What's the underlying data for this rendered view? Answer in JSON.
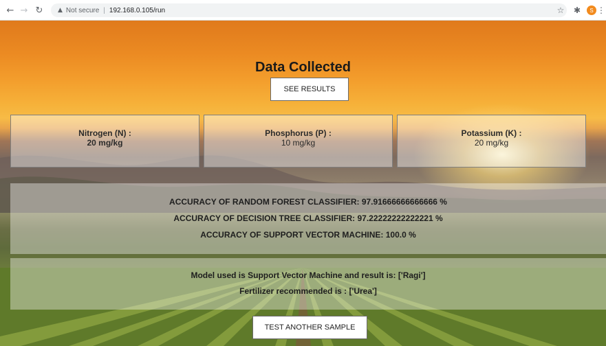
{
  "browser": {
    "security_label": "Not secure",
    "url": "192.168.0.105/run",
    "profile_initial": "S"
  },
  "page": {
    "title": "Data Collected",
    "see_results_label": "SEE RESULTS",
    "nutrients": [
      {
        "label": "Nitrogen (N) :",
        "value": "20 mg/kg"
      },
      {
        "label": "Phosphorus (P) :",
        "value": "10 mg/kg"
      },
      {
        "label": "Potassium (K) :",
        "value": "20 mg/kg"
      }
    ],
    "accuracies": [
      "ACCURACY OF RANDOM FOREST CLASSIFIER: 97.91666666666666 %",
      "ACCURACY OF DECISION TREE CLASSIFIER: 97.22222222222221 %",
      "ACCURACY OF SUPPORT VECTOR MACHINE: 100.0 %"
    ],
    "model_result": "Model used is Support Vector Machine and result is: ['Ragi']",
    "fertilizer": "Fertilizer recommended is : ['Urea']",
    "test_another_label": "TEST ANOTHER SAMPLE"
  }
}
